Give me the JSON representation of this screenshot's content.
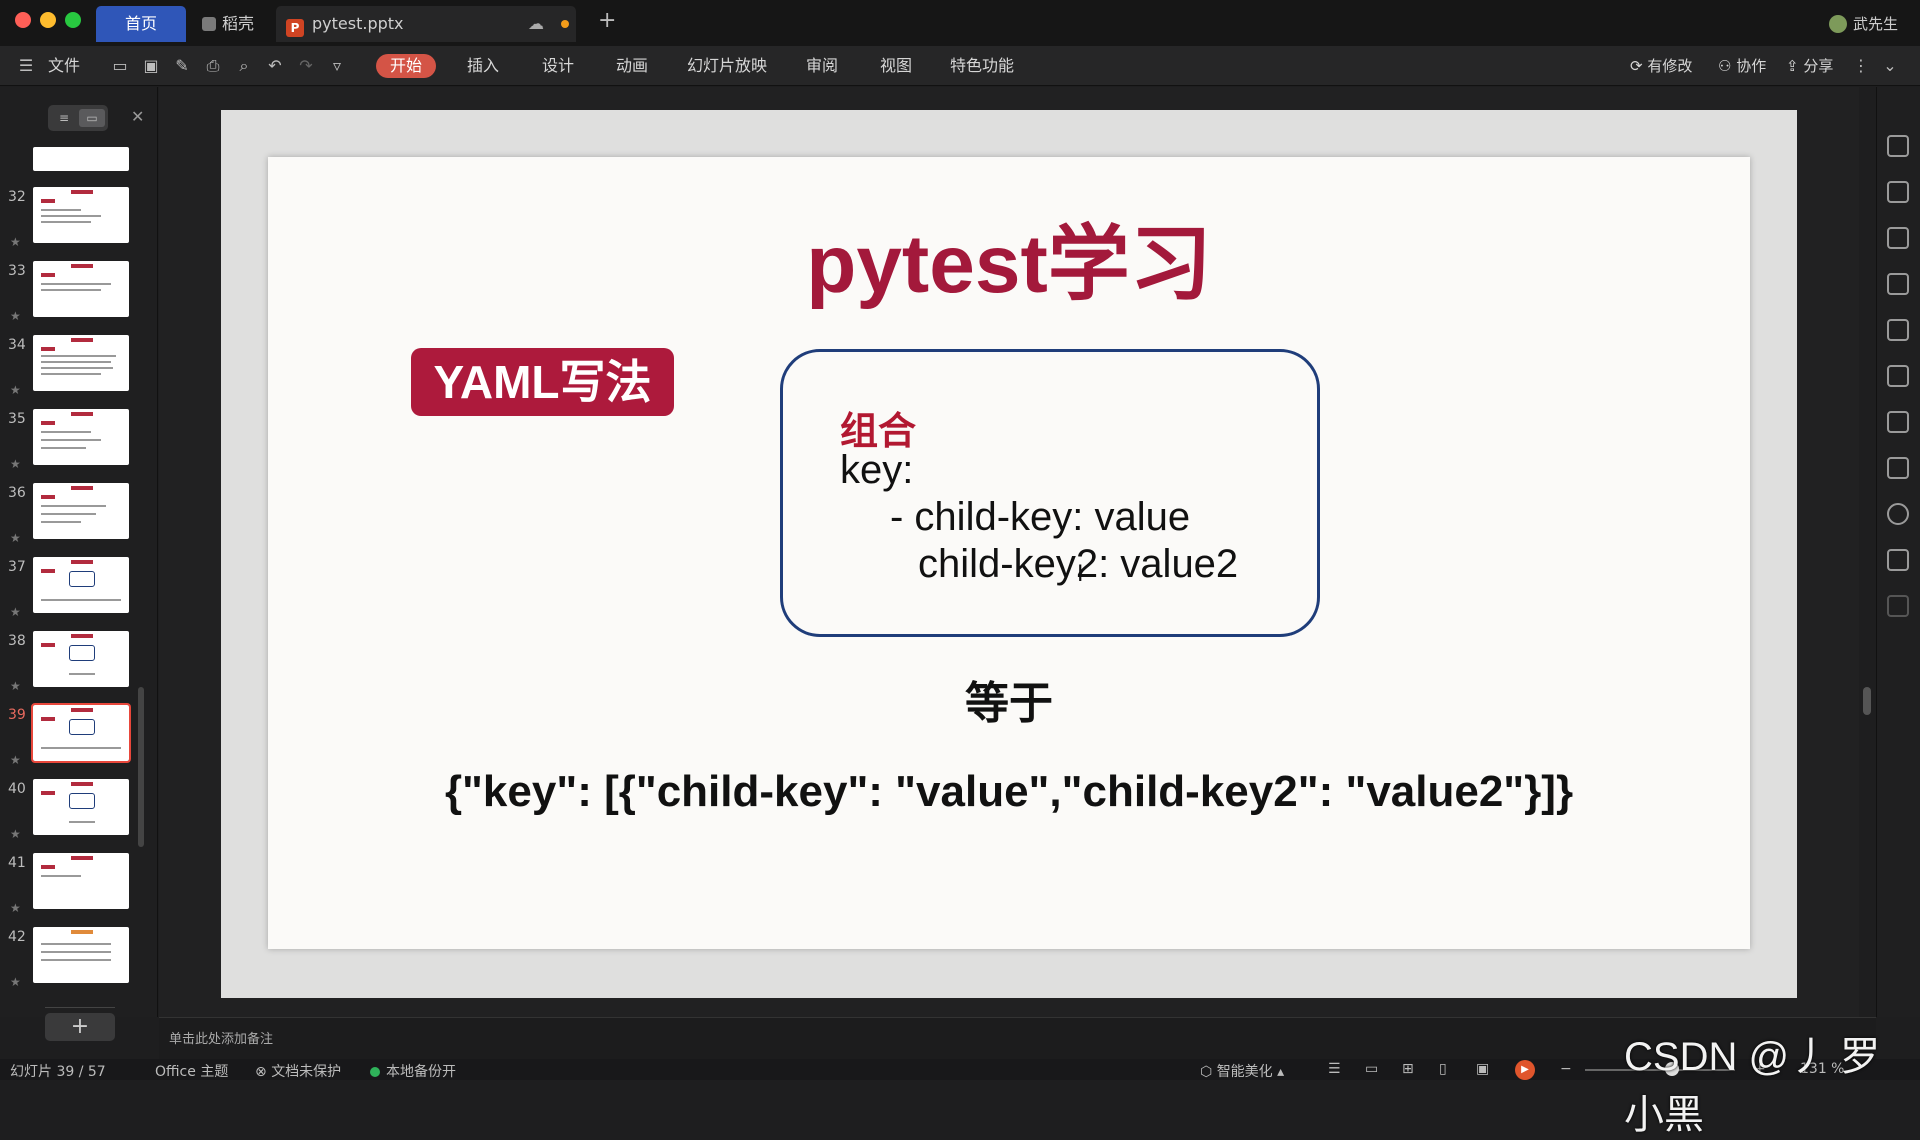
{
  "titlebar": {
    "tabs": [
      {
        "label": "首页"
      },
      {
        "label": "稻壳"
      },
      {
        "label": "pytest.pptx"
      }
    ],
    "user": "武先生"
  },
  "toolbar": {
    "file_menu": "文件",
    "ribbon_tabs": [
      "开始",
      "插入",
      "设计",
      "动画",
      "幻灯片放映",
      "审阅",
      "视图",
      "特色功能"
    ],
    "active_tab": "开始",
    "right_actions": [
      "有修改",
      "协作",
      "分享"
    ]
  },
  "slides_pane": {
    "thumbnails": [
      {
        "number": "32"
      },
      {
        "number": "33"
      },
      {
        "number": "34"
      },
      {
        "number": "35"
      },
      {
        "number": "36"
      },
      {
        "number": "37"
      },
      {
        "number": "38"
      },
      {
        "number": "39"
      },
      {
        "number": "40"
      },
      {
        "number": "41"
      },
      {
        "number": "42"
      }
    ],
    "active_slide": "39"
  },
  "slide": {
    "title": "pytest学习",
    "tag": "YAML写法",
    "box_heading": "组合",
    "box_lines": [
      "key:",
      "- child-key: value",
      "child-key2: value2"
    ],
    "equals_label": "等于",
    "json_line": "{\"key\": [{\"child-key\": \"value\",\"child-key2\": \"value2\"}]}"
  },
  "notes": {
    "placeholder": "单击此处添加备注"
  },
  "statusbar": {
    "slide_counter": "幻灯片 39 / 57",
    "theme": "Office 主题",
    "protection": "文档未保护",
    "backup": "本地备份开",
    "beautify": "智能美化",
    "zoom": "131 %"
  },
  "watermark": "CSDN @丿 罗小黑",
  "colors": {
    "accent": "#ad1a3c",
    "active_tab": "#d45446",
    "home_tab": "#2f56b8"
  }
}
